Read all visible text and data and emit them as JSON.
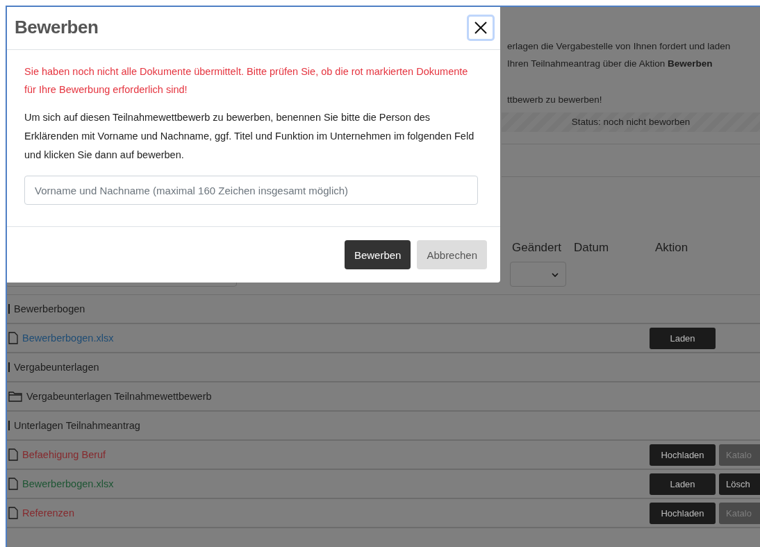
{
  "page": {
    "intro_paragraphs": [
      [
        "erlagen die Vergabestelle von Ihnen fordert und laden",
        "Ihren Teilnahmeantrag über die Aktion **Bewerben**"
      ],
      [
        "ttbewerb zu bewerben!"
      ]
    ],
    "status": "Status: noch nicht beworben",
    "columns": [
      "Geändert",
      "Datum",
      "Aktion"
    ],
    "rows": [
      {
        "kind": "group",
        "label": "Bewerberbogen",
        "buttons": []
      },
      {
        "kind": "file",
        "label": "Bewerberbogen.xlsx",
        "color": "#1f4d75",
        "buttons": [
          {
            "label": "Laden",
            "disabled": false
          }
        ]
      },
      {
        "kind": "group",
        "label": "Vergabeunterlagen",
        "buttons": []
      },
      {
        "kind": "folder",
        "label": "Vergabeunterlagen Teilnahmewettbewerb",
        "buttons": []
      },
      {
        "kind": "group",
        "label": "Unterlagen Teilnahmeantrag",
        "buttons": []
      },
      {
        "kind": "file",
        "label": "Befaehigung Beruf",
        "color": "#862a2e",
        "buttons": [
          {
            "label": "Hochladen",
            "disabled": false
          },
          {
            "label": "Katalo",
            "disabled": true
          }
        ]
      },
      {
        "kind": "file",
        "label": "Bewerberbogen.xlsx",
        "color": "#1e5634",
        "buttons": [
          {
            "label": "Laden",
            "disabled": false
          },
          {
            "label": "Lösch",
            "disabled": false
          }
        ]
      },
      {
        "kind": "file",
        "label": "Referenzen",
        "color": "#862a2e",
        "buttons": [
          {
            "label": "Hochladen",
            "disabled": false
          },
          {
            "label": "Katalo",
            "disabled": true
          }
        ]
      }
    ]
  },
  "dialog": {
    "title": "Bewerben",
    "warning": "Sie haben noch nicht alle Dokumente übermittelt. Bitte prüfen Sie, ob die rot markierten Dokumente für Ihre Bewerbung erforderlich sind!",
    "text": "Um sich auf diesen Teilnahmewettbewerb zu bewerben, benennen Sie bitte die Person des Erklärenden mit Vorname und Nachname, ggf. Titel und Funktion im Unternehmen im folgenden Feld und klicken Sie dann auf bewerben.",
    "field": {
      "placeholder": "Vorname und Nachname (maximal 160 Zeichen insgesamt möglich)"
    },
    "buttons": [
      {
        "label": "Bewerben",
        "kind": "primary"
      },
      {
        "label": "Abbrechen",
        "kind": "secondary"
      }
    ]
  }
}
